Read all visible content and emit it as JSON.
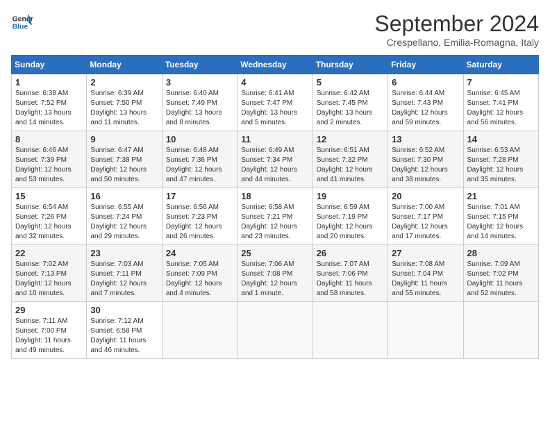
{
  "header": {
    "logo_line1": "General",
    "logo_line2": "Blue",
    "month": "September 2024",
    "location": "Crespellano, Emilia-Romagna, Italy"
  },
  "days_of_week": [
    "Sunday",
    "Monday",
    "Tuesday",
    "Wednesday",
    "Thursday",
    "Friday",
    "Saturday"
  ],
  "weeks": [
    [
      {
        "day": 1,
        "info": "Sunrise: 6:38 AM\nSunset: 7:52 PM\nDaylight: 13 hours\nand 14 minutes."
      },
      {
        "day": 2,
        "info": "Sunrise: 6:39 AM\nSunset: 7:50 PM\nDaylight: 13 hours\nand 11 minutes."
      },
      {
        "day": 3,
        "info": "Sunrise: 6:40 AM\nSunset: 7:49 PM\nDaylight: 13 hours\nand 8 minutes."
      },
      {
        "day": 4,
        "info": "Sunrise: 6:41 AM\nSunset: 7:47 PM\nDaylight: 13 hours\nand 5 minutes."
      },
      {
        "day": 5,
        "info": "Sunrise: 6:42 AM\nSunset: 7:45 PM\nDaylight: 13 hours\nand 2 minutes."
      },
      {
        "day": 6,
        "info": "Sunrise: 6:44 AM\nSunset: 7:43 PM\nDaylight: 12 hours\nand 59 minutes."
      },
      {
        "day": 7,
        "info": "Sunrise: 6:45 AM\nSunset: 7:41 PM\nDaylight: 12 hours\nand 56 minutes."
      }
    ],
    [
      {
        "day": 8,
        "info": "Sunrise: 6:46 AM\nSunset: 7:39 PM\nDaylight: 12 hours\nand 53 minutes."
      },
      {
        "day": 9,
        "info": "Sunrise: 6:47 AM\nSunset: 7:38 PM\nDaylight: 12 hours\nand 50 minutes."
      },
      {
        "day": 10,
        "info": "Sunrise: 6:48 AM\nSunset: 7:36 PM\nDaylight: 12 hours\nand 47 minutes."
      },
      {
        "day": 11,
        "info": "Sunrise: 6:49 AM\nSunset: 7:34 PM\nDaylight: 12 hours\nand 44 minutes."
      },
      {
        "day": 12,
        "info": "Sunrise: 6:51 AM\nSunset: 7:32 PM\nDaylight: 12 hours\nand 41 minutes."
      },
      {
        "day": 13,
        "info": "Sunrise: 6:52 AM\nSunset: 7:30 PM\nDaylight: 12 hours\nand 38 minutes."
      },
      {
        "day": 14,
        "info": "Sunrise: 6:53 AM\nSunset: 7:28 PM\nDaylight: 12 hours\nand 35 minutes."
      }
    ],
    [
      {
        "day": 15,
        "info": "Sunrise: 6:54 AM\nSunset: 7:26 PM\nDaylight: 12 hours\nand 32 minutes."
      },
      {
        "day": 16,
        "info": "Sunrise: 6:55 AM\nSunset: 7:24 PM\nDaylight: 12 hours\nand 29 minutes."
      },
      {
        "day": 17,
        "info": "Sunrise: 6:56 AM\nSunset: 7:23 PM\nDaylight: 12 hours\nand 26 minutes."
      },
      {
        "day": 18,
        "info": "Sunrise: 6:58 AM\nSunset: 7:21 PM\nDaylight: 12 hours\nand 23 minutes."
      },
      {
        "day": 19,
        "info": "Sunrise: 6:59 AM\nSunset: 7:19 PM\nDaylight: 12 hours\nand 20 minutes."
      },
      {
        "day": 20,
        "info": "Sunrise: 7:00 AM\nSunset: 7:17 PM\nDaylight: 12 hours\nand 17 minutes."
      },
      {
        "day": 21,
        "info": "Sunrise: 7:01 AM\nSunset: 7:15 PM\nDaylight: 12 hours\nand 14 minutes."
      }
    ],
    [
      {
        "day": 22,
        "info": "Sunrise: 7:02 AM\nSunset: 7:13 PM\nDaylight: 12 hours\nand 10 minutes."
      },
      {
        "day": 23,
        "info": "Sunrise: 7:03 AM\nSunset: 7:11 PM\nDaylight: 12 hours\nand 7 minutes."
      },
      {
        "day": 24,
        "info": "Sunrise: 7:05 AM\nSunset: 7:09 PM\nDaylight: 12 hours\nand 4 minutes."
      },
      {
        "day": 25,
        "info": "Sunrise: 7:06 AM\nSunset: 7:08 PM\nDaylight: 12 hours\nand 1 minute."
      },
      {
        "day": 26,
        "info": "Sunrise: 7:07 AM\nSunset: 7:06 PM\nDaylight: 11 hours\nand 58 minutes."
      },
      {
        "day": 27,
        "info": "Sunrise: 7:08 AM\nSunset: 7:04 PM\nDaylight: 11 hours\nand 55 minutes."
      },
      {
        "day": 28,
        "info": "Sunrise: 7:09 AM\nSunset: 7:02 PM\nDaylight: 11 hours\nand 52 minutes."
      }
    ],
    [
      {
        "day": 29,
        "info": "Sunrise: 7:11 AM\nSunset: 7:00 PM\nDaylight: 11 hours\nand 49 minutes."
      },
      {
        "day": 30,
        "info": "Sunrise: 7:12 AM\nSunset: 6:58 PM\nDaylight: 11 hours\nand 46 minutes."
      },
      null,
      null,
      null,
      null,
      null
    ]
  ]
}
